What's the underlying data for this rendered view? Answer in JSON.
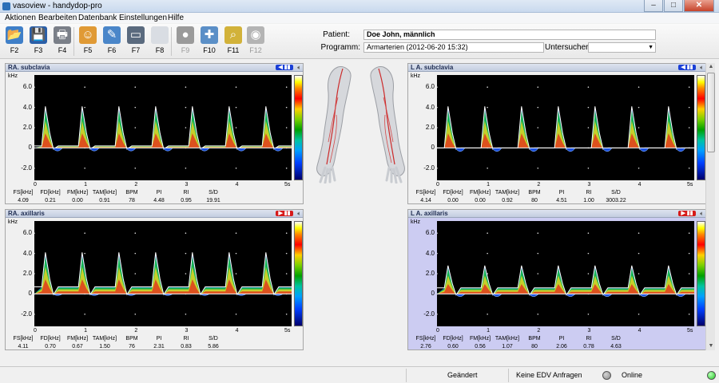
{
  "window": {
    "title": "vasoview - handydop-pro",
    "min": "–",
    "max": "□",
    "close": "✕"
  },
  "menu": [
    "Aktionen",
    "Bearbeiten",
    "Datenbank",
    "Einstellungen",
    "Hilfe"
  ],
  "toolbar": [
    {
      "key": "F2",
      "icon": "open-folder-icon",
      "color": "#3f7fc8",
      "glyph": "📂",
      "enabled": true
    },
    {
      "key": "F3",
      "icon": "save-disk-icon",
      "color": "#2b5fa8",
      "glyph": "💾",
      "enabled": true
    },
    {
      "key": "F4",
      "icon": "printer-icon",
      "color": "#7a7f88",
      "glyph": "🖶",
      "enabled": true
    },
    {
      "key": "F5",
      "icon": "patient-icon",
      "color": "#e09a35",
      "glyph": "☺",
      "enabled": true
    },
    {
      "key": "F6",
      "icon": "edit-record-icon",
      "color": "#4a86c9",
      "glyph": "✎",
      "enabled": true
    },
    {
      "key": "F7",
      "icon": "monitor-icon",
      "color": "#5a6a7e",
      "glyph": "▭",
      "enabled": true
    },
    {
      "key": "F8",
      "icon": "blank-page-icon",
      "color": "#d9dde3",
      "glyph": "",
      "enabled": true
    },
    {
      "key": "F9",
      "icon": "record-button-icon",
      "color": "#9a9a9a",
      "glyph": "●",
      "enabled": false
    },
    {
      "key": "F10",
      "icon": "probe-syringe-icon",
      "color": "#5b8fc7",
      "glyph": "✚",
      "enabled": true
    },
    {
      "key": "F11",
      "icon": "magnifier-icon",
      "color": "#d2b23a",
      "glyph": "⌕",
      "enabled": true
    },
    {
      "key": "F12",
      "icon": "speaker-volume-icon",
      "color": "#b4b4b4",
      "glyph": "◉",
      "enabled": false
    }
  ],
  "patient": {
    "patient_label": "Patient:",
    "patient_value": "Doe John, männlich",
    "program_label": "Programm:",
    "program_value": "Armarterien (2012-06-20 15:32)",
    "examiner_label": "Untersucher:",
    "examiner_value": ""
  },
  "panels": [
    {
      "name": "RA. subclavia",
      "direction_color": "#1a3fd6",
      "direction_glyph": "◀ ▮▮",
      "metric_headers": [
        "FS[kHz]",
        "FD[kHz]",
        "FM[kHz]",
        "TAM[kHz]",
        "BPM",
        "PI",
        "RI",
        "S/D"
      ],
      "metric_values": [
        "4.09",
        "0.21",
        "0.00",
        "0.91",
        "78",
        "4.48",
        "0.95",
        "19.91"
      ],
      "waveform": {
        "peak": 4.1,
        "diastolic": 0.2,
        "reverse": -0.6,
        "beats": 7
      }
    },
    {
      "name": "L A. subclavia",
      "direction_color": "#1a3fd6",
      "direction_glyph": "◀ ▮▮",
      "metric_headers": [
        "FS[kHz]",
        "FD[kHz]",
        "FM[kHz]",
        "TAM[kHz]",
        "BPM",
        "PI",
        "RI",
        "S/D"
      ],
      "metric_values": [
        "4.14",
        "0.00",
        "0.00",
        "0.92",
        "80",
        "4.51",
        "1.00",
        "3003.22"
      ],
      "waveform": {
        "peak": 4.1,
        "diastolic": 0.0,
        "reverse": -0.7,
        "beats": 7
      }
    },
    {
      "name": "RA. axillaris",
      "direction_color": "#d61a1a",
      "direction_glyph": "▶ ▮▮",
      "metric_headers": [
        "FS[kHz]",
        "FD[kHz]",
        "FM[kHz]",
        "TAM[kHz]",
        "BPM",
        "PI",
        "RI",
        "S/D"
      ],
      "metric_values": [
        "4.11",
        "0.70",
        "0.67",
        "1.50",
        "76",
        "2.31",
        "0.83",
        "5.86"
      ],
      "waveform": {
        "peak": 4.1,
        "diastolic": 0.7,
        "reverse": -0.3,
        "beats": 7
      }
    },
    {
      "name": "L A. axillaris",
      "direction_color": "#d61a1a",
      "direction_glyph": "▶ ▮▮",
      "metric_headers": [
        "FS[kHz]",
        "FD[kHz]",
        "FM[kHz]",
        "TAM[kHz]",
        "BPM",
        "PI",
        "RI",
        "S/D"
      ],
      "metric_values": [
        "2.76",
        "0.60",
        "0.56",
        "1.07",
        "80",
        "2.06",
        "0.78",
        "4.63"
      ],
      "waveform": {
        "peak": 2.8,
        "diastolic": 0.6,
        "reverse": -0.5,
        "beats": 7
      }
    }
  ],
  "axes": {
    "y_unit": "kHz",
    "y_ticks": [
      "6.0",
      "4.0",
      "2.0",
      "0",
      "-2.0"
    ],
    "y_values": [
      6,
      4,
      2,
      0,
      -2
    ],
    "y_range": [
      -3.2,
      7.2
    ],
    "x_ticks": [
      "0",
      "1",
      "2",
      "3",
      "4",
      "5s"
    ],
    "x_range": [
      0,
      5.1
    ]
  },
  "status": {
    "changed": "Geändert",
    "edv": "Keine EDV Anfragen",
    "online": "Online",
    "led_off": "#8a8a8a",
    "led_on": "#22c922"
  }
}
